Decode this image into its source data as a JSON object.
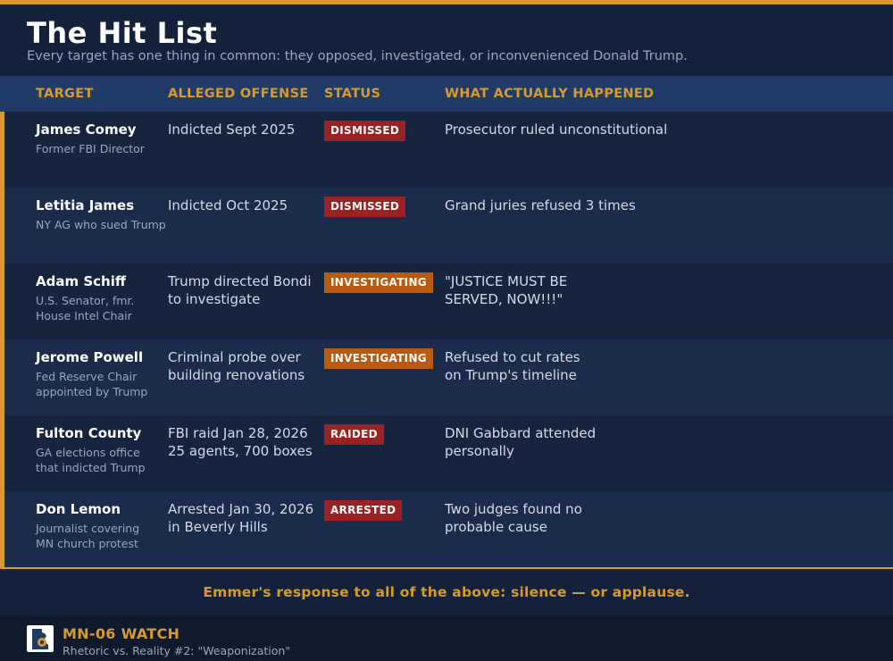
{
  "header": {
    "title": "The Hit List",
    "subtitle": "Every target has one thing in common: they opposed, investigated, or inconvenienced Donald Trump."
  },
  "columns": {
    "target": "TARGET",
    "offense": "ALLEGED OFFENSE",
    "status": "STATUS",
    "happened": "WHAT ACTUALLY HAPPENED"
  },
  "rows": [
    {
      "name": "James Comey",
      "role": "Former FBI Director",
      "offense": "Indicted Sept 2025",
      "status": "DISMISSED",
      "status_color": "#9b2222",
      "happened": "Prosecutor ruled unconstitutional"
    },
    {
      "name": "Letitia James",
      "role": "NY AG who sued Trump",
      "offense": "Indicted Oct 2025",
      "status": "DISMISSED",
      "status_color": "#9b2222",
      "happened": "Grand juries refused 3 times"
    },
    {
      "name": "Adam Schiff",
      "role": "U.S. Senator, fmr. House Intel Chair",
      "offense": "Trump directed Bondi to investigate",
      "status": "INVESTIGATING",
      "status_color": "#b85a10",
      "happened": "\"JUSTICE MUST BE SERVED, NOW!!!\""
    },
    {
      "name": "Jerome Powell",
      "role": "Fed Reserve Chair appointed by Trump",
      "offense": "Criminal probe over building renovations",
      "status": "INVESTIGATING",
      "status_color": "#b85a10",
      "happened": "Refused to cut rates on Trump's timeline"
    },
    {
      "name": "Fulton County",
      "role": "GA elections office that indicted Trump",
      "offense": "FBI raid Jan 28, 2026 25 agents, 700 boxes",
      "status": "RAIDED",
      "status_color": "#9b2222",
      "happened": "DNI Gabbard attended personally"
    },
    {
      "name": "Don Lemon",
      "role": "Journalist covering MN church protest",
      "offense": "Arrested Jan 30, 2026 in Beverly Hills",
      "status": "ARRESTED",
      "status_color": "#9b2222",
      "happened": "Two judges found no probable cause"
    }
  ],
  "response": "Emmer's response to all of the above:  silence — or applause.",
  "footer": {
    "logo_icon": "minnesota-map-icon",
    "brand": "MN-06 WATCH",
    "tagline": "Rhetoric vs. Reality #2: \"Weaponization\""
  },
  "colors": {
    "accent": "#d89a2b",
    "header_band": "#1f3b66",
    "row_odd": "#16243d",
    "row_even": "#1a2b4b"
  }
}
